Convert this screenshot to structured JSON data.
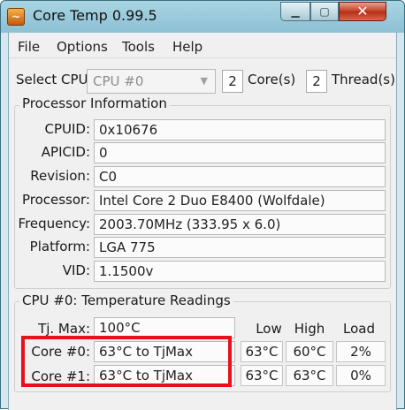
{
  "window": {
    "title": "Core Temp 0.99.5",
    "icon": "core-temp-app-icon"
  },
  "menu": [
    "File",
    "Options",
    "Tools",
    "Help"
  ],
  "cpu_select": {
    "label": "Select CPU:",
    "value": "CPU #0",
    "cores": "2",
    "cores_label": "Core(s)",
    "threads": "2",
    "threads_label": "Thread(s)"
  },
  "processor": {
    "title": "Processor Information",
    "fields": [
      {
        "label": "CPUID:",
        "value": "0x10676"
      },
      {
        "label": "APICID:",
        "value": "0"
      },
      {
        "label": "Revision:",
        "value": "C0"
      },
      {
        "label": "Processor:",
        "value": "Intel Core 2 Duo E8400 (Wolfdale)"
      },
      {
        "label": "Frequency:",
        "value": "2003.70MHz (333.95 x 6.0)"
      },
      {
        "label": "Platform:",
        "value": "LGA 775"
      },
      {
        "label": "VID:",
        "value": "1.1500v"
      }
    ]
  },
  "temps": {
    "title": "CPU #0: Temperature Readings",
    "tjmax_label": "Tj. Max:",
    "tjmax_value": "100°C",
    "headers": {
      "low": "Low",
      "high": "High",
      "load": "Load"
    },
    "cores": [
      {
        "label": "Core #0:",
        "value": "63°C to TjMax",
        "low": "63°C",
        "high": "60°C",
        "load": "2%"
      },
      {
        "label": "Core #1:",
        "value": "63°C to TjMax",
        "low": "63°C",
        "high": "63°C",
        "load": "0%"
      }
    ]
  },
  "colors": {
    "highlight": "#e8101a",
    "close_button": "#c54025"
  }
}
